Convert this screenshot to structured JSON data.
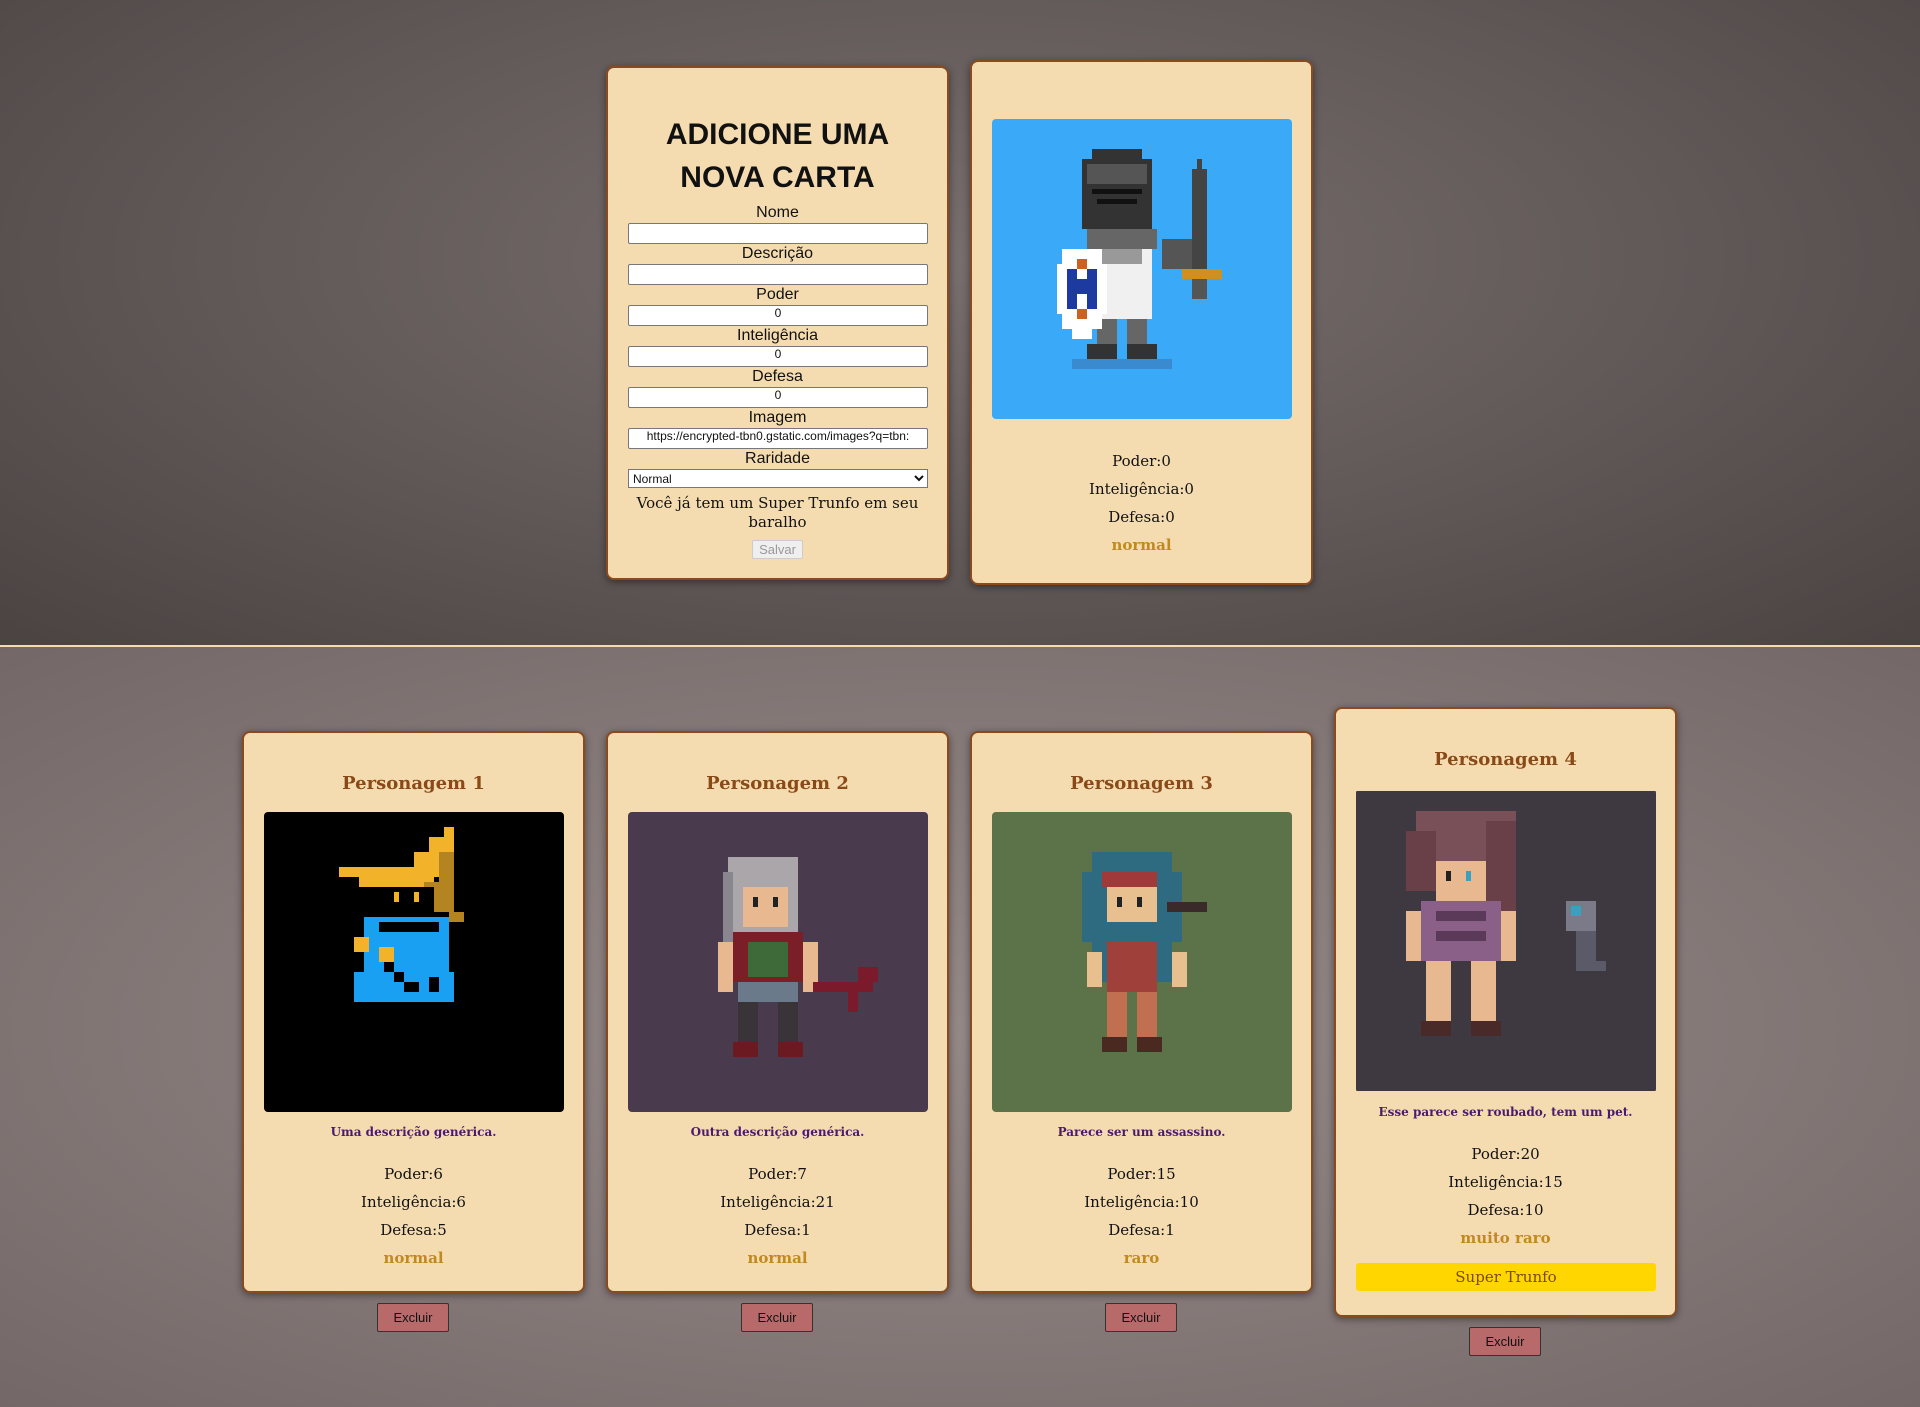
{
  "form": {
    "title": "ADICIONE UMA NOVA CARTA",
    "fields": {
      "name": {
        "label": "Nome",
        "value": ""
      },
      "description": {
        "label": "Descrição",
        "value": ""
      },
      "power": {
        "label": "Poder",
        "value": "0"
      },
      "intelligence": {
        "label": "Inteligência",
        "value": "0"
      },
      "defense": {
        "label": "Defesa",
        "value": "0"
      },
      "image": {
        "label": "Imagem",
        "value": "https://encrypted-tbn0.gstatic.com/images?q=tbn:"
      },
      "rarity": {
        "label": "Raridade",
        "value": "Normal"
      }
    },
    "trunfo_message": "Você já tem um Super Trunfo em seu baralho",
    "save_label": "Salvar"
  },
  "preview": {
    "power": "Poder:0",
    "intelligence": "Inteligência:0",
    "defense": "Defesa:0",
    "rarity": "normal",
    "image_bg": "#3aaaf8",
    "image_icon": "knight-sprite"
  },
  "cards": [
    {
      "name": "Personagem 1",
      "description": "Uma descrição genérica.",
      "power": "Poder:6",
      "intelligence": "Inteligência:6",
      "defense": "Defesa:5",
      "rarity": "normal",
      "image_bg": "#000000",
      "image_icon": "black-mage-sprite",
      "delete_label": "Excluir"
    },
    {
      "name": "Personagem 2",
      "description": "Outra descrição genérica.",
      "power": "Poder:7",
      "intelligence": "Inteligência:21",
      "defense": "Defesa:1",
      "rarity": "normal",
      "image_bg": "#4a3a4e",
      "image_icon": "grey-haired-warrior-sprite",
      "delete_label": "Excluir"
    },
    {
      "name": "Personagem 3",
      "description": "Parece ser um assassino.",
      "power": "Poder:15",
      "intelligence": "Inteligência:10",
      "defense": "Defesa:1",
      "rarity": "raro",
      "image_bg": "#5c7248",
      "image_icon": "hooded-assassin-sprite",
      "delete_label": "Excluir"
    },
    {
      "name": "Personagem 4",
      "description": "Esse parece ser roubado, tem um pet.",
      "power": "Poder:20",
      "intelligence": "Inteligência:15",
      "defense": "Defesa:10",
      "rarity": "muito raro",
      "trunfo_label": "Super Trunfo",
      "image_bg": "#3e3840",
      "image_icon": "girl-with-pet-sprite",
      "delete_label": "Excluir"
    }
  ],
  "colors": {
    "card_bg": "#f5dcb0",
    "card_border": "#8a4a20",
    "rarity": "#c08a1f",
    "card_name": "#8a4a18",
    "description": "#4b1a6e",
    "trunfo": "#ffd600",
    "delete_button": "#b86a6a"
  }
}
